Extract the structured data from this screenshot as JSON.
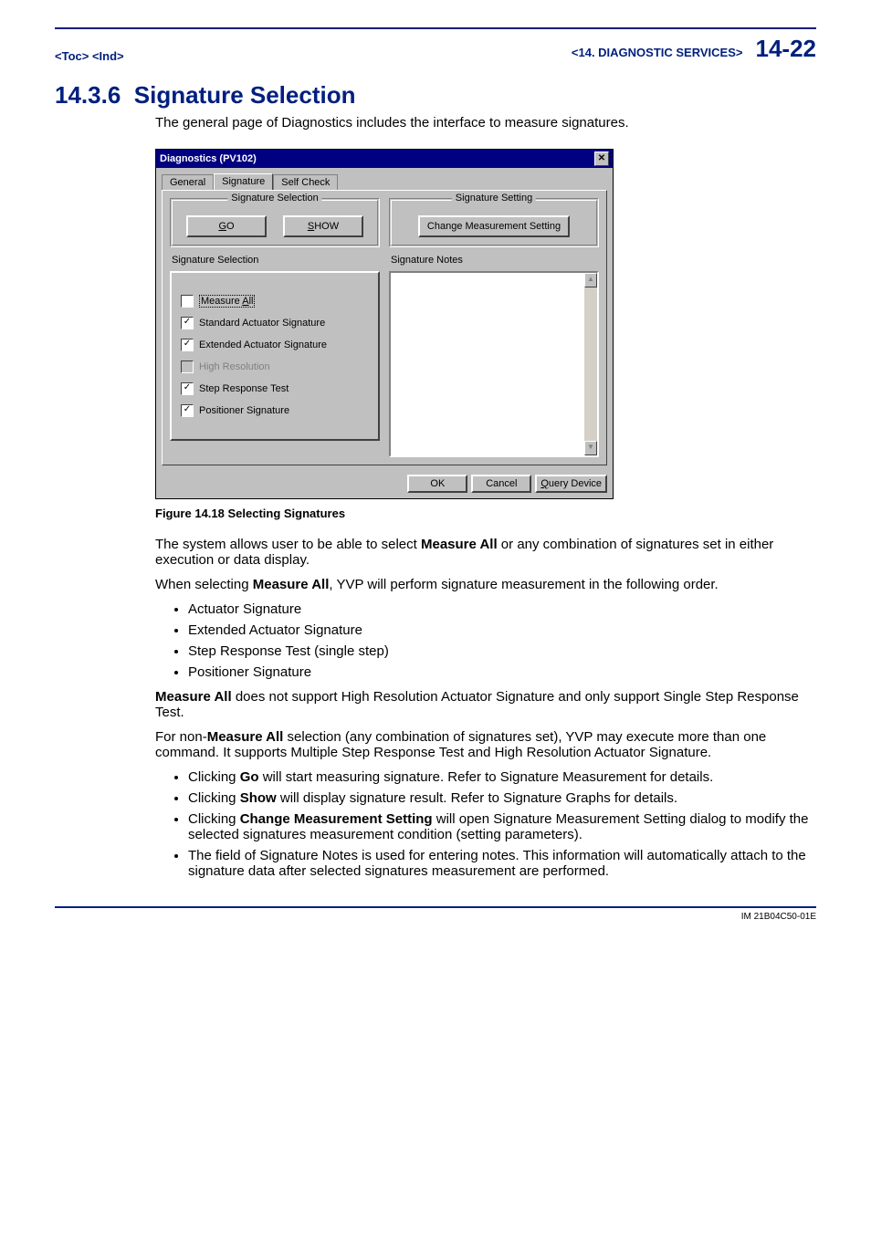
{
  "header": {
    "toc": "<Toc>",
    "ind": "<Ind>",
    "chapter": "<14.  DIAGNOSTIC SERVICES>",
    "page": "14-22"
  },
  "section": {
    "number": "14.3.6",
    "title": "Signature Selection",
    "intro": "The general page of Diagnostics includes the interface to measure signatures."
  },
  "dialog": {
    "title": "Diagnostics (PV102)",
    "tabs": {
      "general": "General",
      "signature": "Signature",
      "selfcheck": "Self Check"
    },
    "sig_selection_group": "Signature Selection",
    "go_btn_pre": "G",
    "go_btn_rest": "O",
    "show_btn_pre": "S",
    "show_btn_rest": "HOW",
    "sig_selection_label": "Signature Selection",
    "checks": {
      "measure_all_pre": "Measure ",
      "measure_all_u": "A",
      "measure_all_rest": "ll",
      "std": "Standard Actuator Signature",
      "ext": "Extended Actuator Signature",
      "hires": "High Resolution",
      "step": "Step Response Test",
      "pos": "Positioner Signature"
    },
    "sig_setting_group": "Signature Setting",
    "change_btn": "Change Measurement Setting",
    "notes_label": "Signature Notes",
    "ok": "OK",
    "cancel": "Cancel",
    "query_u": "Q",
    "query_rest": "uery Device"
  },
  "figure_caption": "Figure 14.18  Selecting Signatures",
  "body": {
    "p1_a": "The system allows user to be able to select ",
    "p1_b": "Measure All",
    "p1_c": " or any combination of signatures set in either execution or data display.",
    "p2_a": "When selecting ",
    "p2_b": "Measure All",
    "p2_c": ", YVP will perform signature measurement in the following order.",
    "list1": {
      "i1": "Actuator Signature",
      "i2": "Extended Actuator Signature",
      "i3": "Step Response Test (single step)",
      "i4": "Positioner Signature"
    },
    "p3_a": "Measure All",
    "p3_b": " does not support High Resolution Actuator Signature and only support Single Step Response Test.",
    "p4_a": "For non-",
    "p4_b": "Measure All",
    "p4_c": " selection (any combination of signatures set), YVP may execute more than one command. It supports Multiple Step Response Test and High Resolution Actuator Signature.",
    "list2": {
      "i1_a": "Clicking ",
      "i1_b": "Go",
      "i1_c": " will start measuring signature. Refer to Signature Measurement for details.",
      "i2_a": "Clicking ",
      "i2_b": "Show",
      "i2_c": " will display signature result.  Refer to Signature Graphs for details.",
      "i3_a": "Clicking ",
      "i3_b": "Change Measurement Setting",
      "i3_c": " will open  Signature Measurement Setting dialog to modify the selected signatures measurement condition (setting parameters).",
      "i4": "The field of Signature Notes is used for entering notes.  This information will automatically attach to the signature data after selected signatures measurement are performed."
    }
  },
  "footer": "IM 21B04C50-01E"
}
